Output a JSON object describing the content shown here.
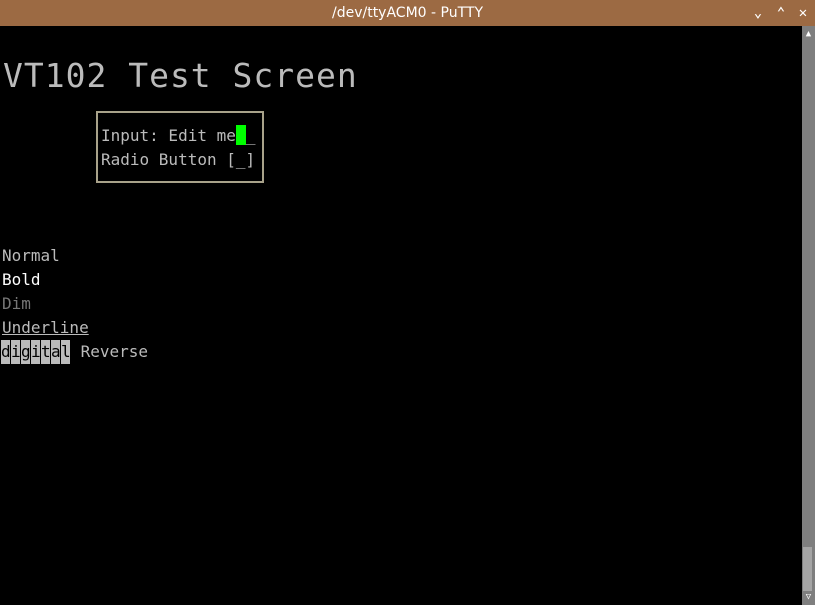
{
  "window": {
    "title": "/dev/ttyACM0 - PuTTY",
    "accent": "#9c6a43"
  },
  "controls": {
    "minimize": "⌄",
    "maximize": "⌃",
    "close": "✕"
  },
  "screen": {
    "heading": "VT102 Test Screen",
    "form": {
      "input_label": "Input: Edit me",
      "input_after": "_",
      "radio_label": "Radio Button [_]"
    },
    "styles": {
      "normal": "Normal",
      "bold": "Bold",
      "dim": "Dim",
      "underline": "Underline",
      "reverse_chars": [
        "d",
        "i",
        "g",
        "i",
        "t",
        "a",
        "l"
      ],
      "reverse_label": " Reverse"
    }
  },
  "scrollbar": {
    "position_percent": 100
  }
}
